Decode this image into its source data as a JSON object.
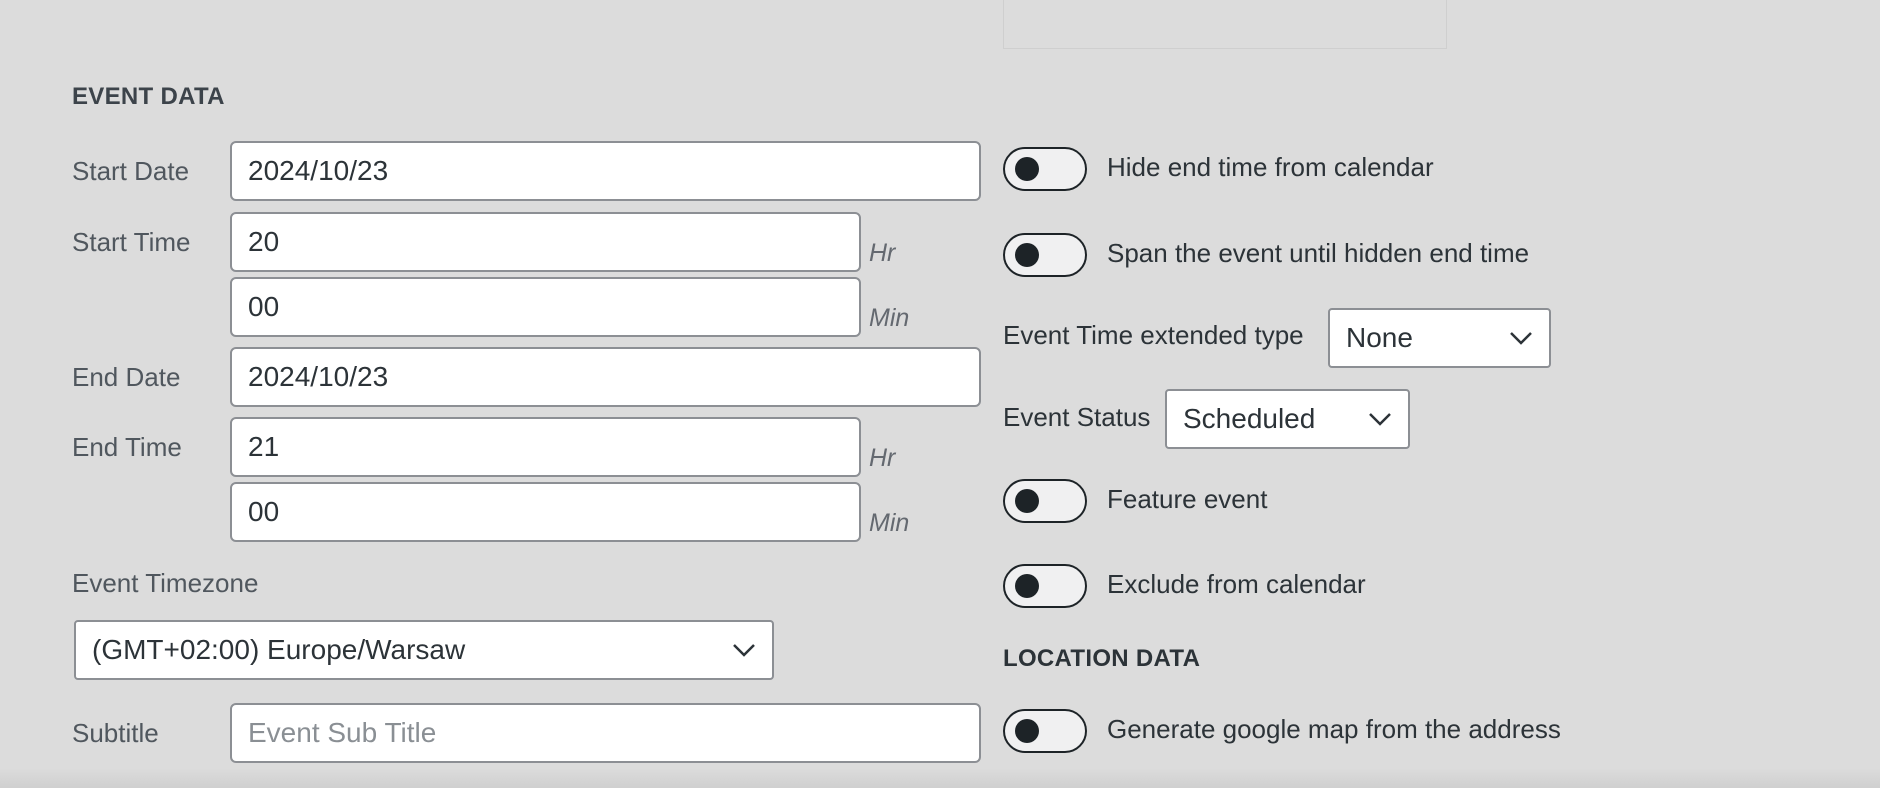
{
  "event_data": {
    "title": "EVENT DATA",
    "start_date": {
      "label": "Start Date",
      "value": "2024/10/23"
    },
    "start_time": {
      "label": "Start Time",
      "hour": "20",
      "hour_unit": "Hr",
      "minute": "00",
      "minute_unit": "Min"
    },
    "end_date": {
      "label": "End Date",
      "value": "2024/10/23"
    },
    "end_time": {
      "label": "End Time",
      "hour": "21",
      "hour_unit": "Hr",
      "minute": "00",
      "minute_unit": "Min"
    },
    "timezone": {
      "label": "Event Timezone",
      "selected": "(GMT+02:00) Europe/Warsaw"
    },
    "subtitle": {
      "label": "Subtitle",
      "placeholder": "Event Sub Title",
      "value": ""
    }
  },
  "options": {
    "hide_end_time": "Hide end time from calendar",
    "span_event": "Span the event until hidden end time",
    "time_extended_type": {
      "label": "Event Time extended type",
      "selected": "None"
    },
    "event_status": {
      "label": "Event Status",
      "selected": "Scheduled"
    },
    "feature_event": "Feature event",
    "exclude_calendar": "Exclude from calendar"
  },
  "location_data": {
    "title": "LOCATION DATA",
    "generate_map": "Generate google map from the address"
  }
}
